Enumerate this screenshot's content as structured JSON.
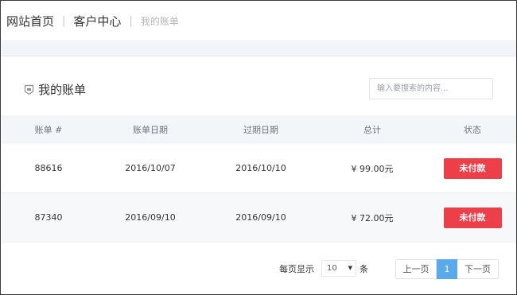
{
  "breadcrumb": {
    "home": "网站首页",
    "separator": "|",
    "customer_center": "客户中心",
    "current": "我的账单"
  },
  "panel": {
    "title": "我的账单",
    "title_icon": "bill-icon",
    "search_placeholder": "输入要搜索的内容..."
  },
  "table": {
    "headers": [
      "账单 #",
      "账单日期",
      "过期日期",
      "总计",
      "状态"
    ],
    "rows": [
      {
        "id": "88616",
        "bill_date": "2016/10/07",
        "due_date": "2016/10/10",
        "total": "¥ 99.00元",
        "status": "未付款"
      },
      {
        "id": "87340",
        "bill_date": "2016/09/10",
        "due_date": "2016/09/10",
        "total": "¥ 72.00元",
        "status": "未付款"
      }
    ]
  },
  "footer": {
    "per_page_label": "每页显示",
    "per_page_value": "10",
    "per_page_unit": "条",
    "prev_label": "上一页",
    "current_page": "1",
    "next_label": "下一页"
  },
  "colors": {
    "status_unpaid": "#ed3f4a",
    "page_active": "#5aa9ea",
    "header_bg": "#f3f6f9"
  }
}
